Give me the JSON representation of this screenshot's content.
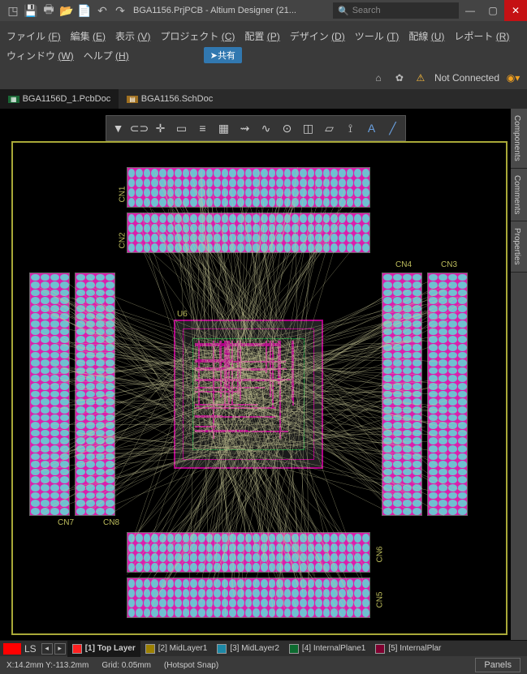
{
  "titlebar": {
    "title": "BGA1156.PrjPCB - Altium Designer (21..."
  },
  "search": {
    "placeholder": "Search"
  },
  "menu": {
    "row1": [
      {
        "l": "ファイル",
        "k": "(F)"
      },
      {
        "l": "編集",
        "k": "(E)"
      },
      {
        "l": "表示",
        "k": "(V)"
      },
      {
        "l": "プロジェクト",
        "k": "(C)"
      },
      {
        "l": "配置",
        "k": "(P)"
      },
      {
        "l": "デザイン",
        "k": "(D)"
      },
      {
        "l": "ツール",
        "k": "(T)"
      },
      {
        "l": "配線",
        "k": "(U)"
      },
      {
        "l": "レポート",
        "k": "(R)"
      }
    ],
    "row2": [
      {
        "l": "ウィンドウ",
        "k": "(W)"
      },
      {
        "l": "ヘルプ",
        "k": "(H)"
      }
    ],
    "share": "共有"
  },
  "connect": {
    "status": "Not Connected"
  },
  "tabs": [
    {
      "label": "BGA1156D_1.PcbDoc",
      "active": true,
      "icon": "pcb-icon"
    },
    {
      "label": "BGA1156.SchDoc",
      "active": false,
      "icon": "sch-icon"
    }
  ],
  "side_tabs": [
    "Components",
    "Comments",
    "Properties"
  ],
  "designators": {
    "u": "U6",
    "cn1": "CN1",
    "cn2": "CN2",
    "cn3": "CN3",
    "cn4": "CN4",
    "cn5": "CN5",
    "cn6": "CN6",
    "cn7": "CN7",
    "cn8": "CN8"
  },
  "layer_bar": {
    "ls": "LS",
    "layers": [
      {
        "name": "[1] Top Layer",
        "color": "#ff2020",
        "active": true
      },
      {
        "name": "[2] MidLayer1",
        "color": "#9c8000",
        "active": false
      },
      {
        "name": "[3] MidLayer2",
        "color": "#1d88a6",
        "active": false
      },
      {
        "name": "[4] InternalPlane1",
        "color": "#0d6b30",
        "active": false
      },
      {
        "name": "[5] InternalPlar",
        "color": "#800030",
        "active": false
      }
    ]
  },
  "status": {
    "coord": "X:14.2mm Y:-113.2mm",
    "grid": "Grid: 0.05mm",
    "snap": "(Hotspot Snap)",
    "panels": "Panels"
  }
}
